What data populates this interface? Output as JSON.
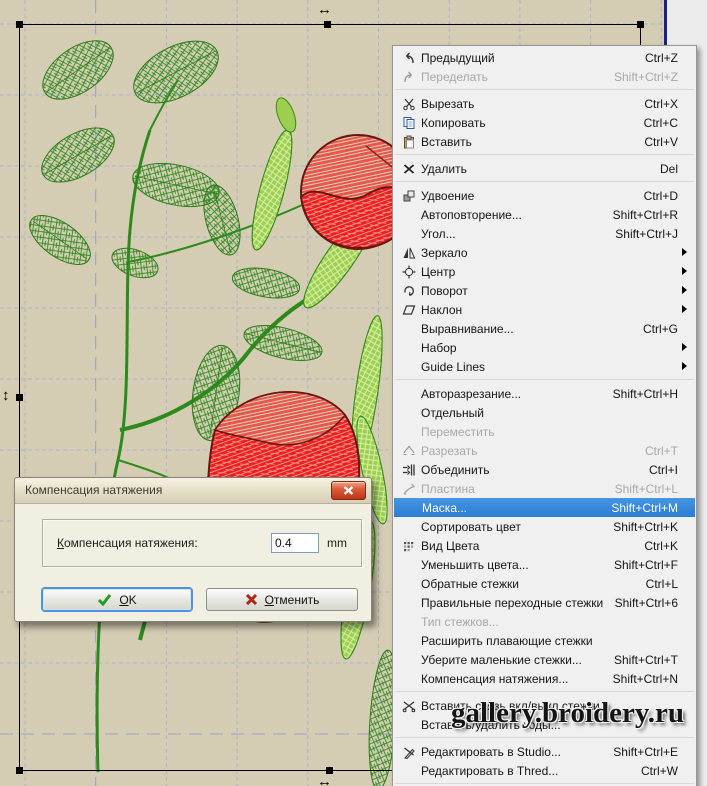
{
  "canvas": {
    "background_color": "#d5cdb3",
    "grid_color": "#a9b3cc",
    "guide_color": "#96a2c6",
    "watermark": "gallery.broidery.ru",
    "cursors": {
      "horizontal": "↔",
      "vertical": "↕"
    }
  },
  "design_colors": {
    "leaf_green": "#2e8a1d",
    "light_green": "#9ccf4f",
    "flower_red": "#ea1f1f",
    "flower_light_red": "#e8564e",
    "flower_outline": "#6d1410"
  },
  "context_menu": {
    "highlight_color": "#2c7cd4",
    "items": [
      {
        "id": "undo",
        "label": "Предыдущий",
        "shortcut": "Ctrl+Z",
        "icon": "undo-icon"
      },
      {
        "id": "redo",
        "label": "Переделать",
        "shortcut": "Shift+Ctrl+Z",
        "icon": "redo-icon",
        "state": "disabled"
      },
      {
        "type": "separator"
      },
      {
        "id": "cut",
        "label": "Вырезать",
        "shortcut": "Ctrl+X",
        "icon": "scissors-icon"
      },
      {
        "id": "copy",
        "label": "Копировать",
        "shortcut": "Ctrl+C",
        "icon": "copy-icon"
      },
      {
        "id": "paste",
        "label": "Вставить",
        "shortcut": "Ctrl+V",
        "icon": "paste-icon"
      },
      {
        "type": "separator"
      },
      {
        "id": "delete",
        "label": "Удалить",
        "shortcut": "Del",
        "icon": "delete-icon"
      },
      {
        "type": "separator"
      },
      {
        "id": "doubling",
        "label": "Удвоение",
        "shortcut": "Ctrl+D",
        "icon": "doubling-icon"
      },
      {
        "id": "autorepeat",
        "label": "Автоповторение...",
        "shortcut": "Shift+Ctrl+R"
      },
      {
        "id": "angle",
        "label": "Угол...",
        "shortcut": "Shift+Ctrl+J"
      },
      {
        "id": "mirror",
        "label": "Зеркало",
        "icon": "mirror-icon",
        "submenu": true
      },
      {
        "id": "center",
        "label": "Центр",
        "icon": "center-icon",
        "submenu": true
      },
      {
        "id": "rotate",
        "label": "Поворот",
        "icon": "rotate-icon",
        "submenu": true
      },
      {
        "id": "skew",
        "label": "Наклон",
        "icon": "skew-icon",
        "submenu": true
      },
      {
        "id": "align",
        "label": "Выравнивание...",
        "shortcut": "Ctrl+G"
      },
      {
        "id": "set",
        "label": "Набор",
        "submenu": true
      },
      {
        "id": "guide-lines",
        "label": "Guide Lines",
        "submenu": true
      },
      {
        "type": "separator"
      },
      {
        "id": "autosplit",
        "label": "Авторазрезание...",
        "shortcut": "Shift+Ctrl+H"
      },
      {
        "id": "separate",
        "label": "Отдельный"
      },
      {
        "id": "move",
        "label": "Переместить",
        "state": "disabled"
      },
      {
        "id": "split",
        "label": "Разрезать",
        "shortcut": "Ctrl+T",
        "icon": "split-icon",
        "state": "disabled"
      },
      {
        "id": "join",
        "label": "Объединить",
        "shortcut": "Ctrl+I",
        "icon": "join-icon"
      },
      {
        "id": "plate",
        "label": "Пластина",
        "shortcut": "Shift+Ctrl+L",
        "icon": "plate-icon",
        "state": "disabled"
      },
      {
        "id": "mask",
        "label": "Маска...",
        "shortcut": "Shift+Ctrl+M",
        "state": "highlighted"
      },
      {
        "id": "sort-color",
        "label": "Сортировать цвет",
        "shortcut": "Shift+Ctrl+K"
      },
      {
        "id": "view-colors",
        "label": "Вид Цвета",
        "shortcut": "Ctrl+K",
        "icon": "colors-icon"
      },
      {
        "id": "reduce-colors",
        "label": "Уменьшить цвета...",
        "shortcut": "Shift+Ctrl+F"
      },
      {
        "id": "reverse-stitches",
        "label": "Обратные стежки",
        "shortcut": "Ctrl+L"
      },
      {
        "id": "transition-stitches",
        "label": "Правильные переходные стежки",
        "shortcut": "Shift+Ctrl+6"
      },
      {
        "id": "stitch-type",
        "label": "Тип стежков...",
        "state": "disabled"
      },
      {
        "id": "expand-floating",
        "label": "Расширить плавающие стежки"
      },
      {
        "id": "remove-small",
        "label": "Уберите маленькие стежки...",
        "shortcut": "Shift+Ctrl+T"
      },
      {
        "id": "pull-compensation",
        "label": "Компенсация натяжения...",
        "shortcut": "Shift+Ctrl+N"
      },
      {
        "type": "separator"
      },
      {
        "id": "insert-tie",
        "label": "Вставить связь вкл/выкл стежки",
        "icon": "tie-icon"
      },
      {
        "id": "insert-codes",
        "label": "Вставить/удалить коды..."
      },
      {
        "type": "separator"
      },
      {
        "id": "edit-studio",
        "label": "Редактировать в Studio...",
        "shortcut": "Shift+Ctrl+E",
        "icon": "studio-icon"
      },
      {
        "id": "edit-thred",
        "label": "Редактировать в Thred...",
        "shortcut": "Ctrl+W"
      },
      {
        "type": "separator"
      }
    ]
  },
  "dialog": {
    "title": "Компенсация натяжения",
    "field_label_accel": "К",
    "field_label_rest": "омпенсация натяжения:",
    "input_value": "0.4",
    "unit": "mm",
    "ok_accel": "O",
    "ok_rest": "K",
    "cancel_accel": "О",
    "cancel_rest": "тменить"
  }
}
